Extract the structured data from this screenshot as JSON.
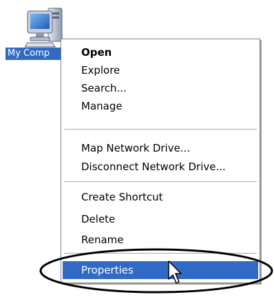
{
  "desktop": {
    "icon_name": "computer-icon",
    "icon_label": "My Comp"
  },
  "context_menu": {
    "items": [
      {
        "label": "Open",
        "bold": true
      },
      {
        "label": "Explore"
      },
      {
        "label": "Search..."
      },
      {
        "label": "Manage"
      },
      {
        "label": "Map Network Drive..."
      },
      {
        "label": "Disconnect Network Drive..."
      },
      {
        "label": "Create Shortcut"
      },
      {
        "label": "Delete"
      },
      {
        "label": "Rename"
      },
      {
        "label": "Properties",
        "selected": true
      }
    ]
  },
  "colors": {
    "selection": "#316ac5",
    "menu_border": "#808080",
    "separator": "#aca899",
    "highlight_ellipse": "#000000"
  }
}
